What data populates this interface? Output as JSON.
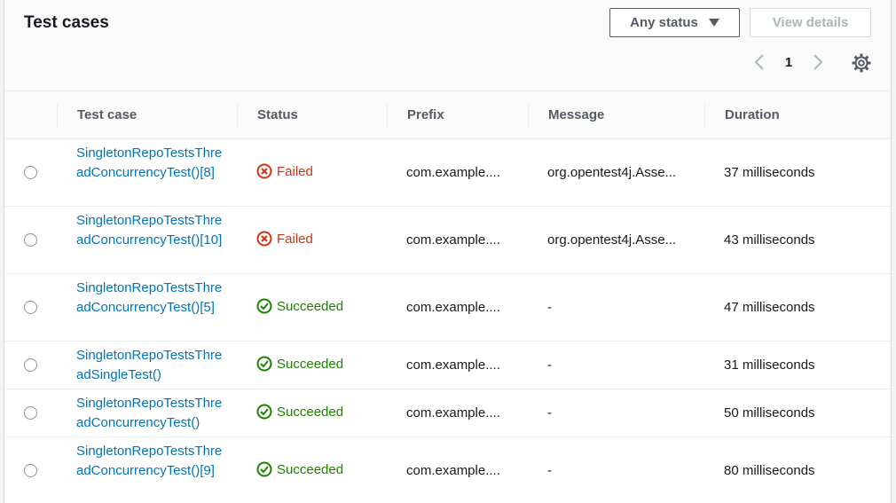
{
  "header": {
    "title": "Test cases",
    "status_filter": "Any status",
    "view_details": "View details",
    "page": "1"
  },
  "columns": {
    "test_case": "Test case",
    "status": "Status",
    "prefix": "Prefix",
    "message": "Message",
    "duration": "Duration"
  },
  "colors": {
    "link": "#0073bb",
    "failed": "#d13212",
    "succeeded": "#1d8102"
  },
  "rows": [
    {
      "test_case": "SingletonRepoTestsThreadConcurrencyTest()[8]",
      "status": "Failed",
      "prefix": "com.example....",
      "message": "org.opentest4j.Asse...",
      "duration": "37 milliseconds"
    },
    {
      "test_case": "SingletonRepoTestsThreadConcurrencyTest()[10]",
      "status": "Failed",
      "prefix": "com.example....",
      "message": "org.opentest4j.Asse...",
      "duration": "43 milliseconds"
    },
    {
      "test_case": "SingletonRepoTestsThreadConcurrencyTest()[5]",
      "status": "Succeeded",
      "prefix": "com.example....",
      "message": "-",
      "duration": "47 milliseconds"
    },
    {
      "test_case": "SingletonRepoTestsThreadSingleTest()",
      "status": "Succeeded",
      "prefix": "com.example....",
      "message": "-",
      "duration": "31 milliseconds"
    },
    {
      "test_case": "SingletonRepoTestsThreadConcurrencyTest()",
      "status": "Succeeded",
      "prefix": "com.example....",
      "message": "-",
      "duration": "50 milliseconds"
    },
    {
      "test_case": "SingletonRepoTestsThreadConcurrencyTest()[9]",
      "status": "Succeeded",
      "prefix": "com.example....",
      "message": "-",
      "duration": "80 milliseconds"
    }
  ]
}
